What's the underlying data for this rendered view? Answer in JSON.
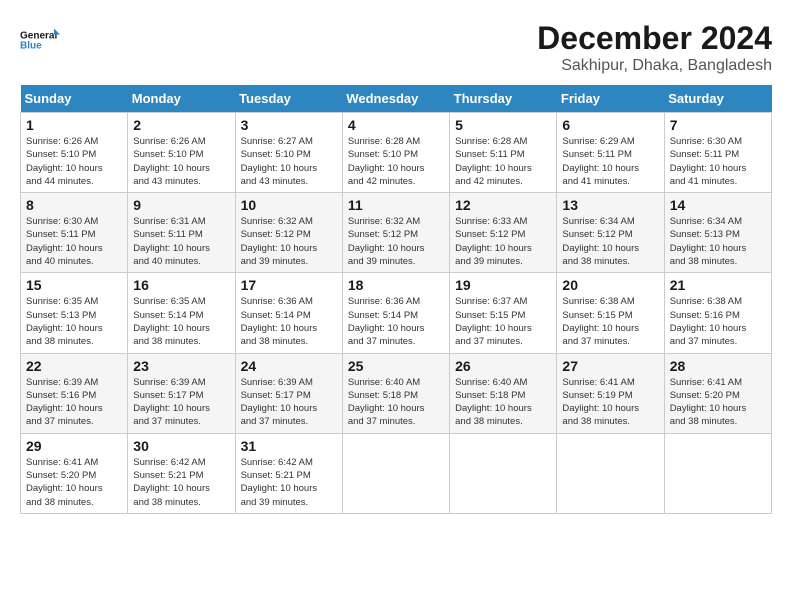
{
  "logo": {
    "text_general": "General",
    "text_blue": "Blue"
  },
  "title": "December 2024",
  "location": "Sakhipur, Dhaka, Bangladesh",
  "days_of_week": [
    "Sunday",
    "Monday",
    "Tuesday",
    "Wednesday",
    "Thursday",
    "Friday",
    "Saturday"
  ],
  "weeks": [
    [
      {
        "day": 1,
        "info": "Sunrise: 6:26 AM\nSunset: 5:10 PM\nDaylight: 10 hours\nand 44 minutes."
      },
      {
        "day": 2,
        "info": "Sunrise: 6:26 AM\nSunset: 5:10 PM\nDaylight: 10 hours\nand 43 minutes."
      },
      {
        "day": 3,
        "info": "Sunrise: 6:27 AM\nSunset: 5:10 PM\nDaylight: 10 hours\nand 43 minutes."
      },
      {
        "day": 4,
        "info": "Sunrise: 6:28 AM\nSunset: 5:10 PM\nDaylight: 10 hours\nand 42 minutes."
      },
      {
        "day": 5,
        "info": "Sunrise: 6:28 AM\nSunset: 5:11 PM\nDaylight: 10 hours\nand 42 minutes."
      },
      {
        "day": 6,
        "info": "Sunrise: 6:29 AM\nSunset: 5:11 PM\nDaylight: 10 hours\nand 41 minutes."
      },
      {
        "day": 7,
        "info": "Sunrise: 6:30 AM\nSunset: 5:11 PM\nDaylight: 10 hours\nand 41 minutes."
      }
    ],
    [
      {
        "day": 8,
        "info": "Sunrise: 6:30 AM\nSunset: 5:11 PM\nDaylight: 10 hours\nand 40 minutes."
      },
      {
        "day": 9,
        "info": "Sunrise: 6:31 AM\nSunset: 5:11 PM\nDaylight: 10 hours\nand 40 minutes."
      },
      {
        "day": 10,
        "info": "Sunrise: 6:32 AM\nSunset: 5:12 PM\nDaylight: 10 hours\nand 39 minutes."
      },
      {
        "day": 11,
        "info": "Sunrise: 6:32 AM\nSunset: 5:12 PM\nDaylight: 10 hours\nand 39 minutes."
      },
      {
        "day": 12,
        "info": "Sunrise: 6:33 AM\nSunset: 5:12 PM\nDaylight: 10 hours\nand 39 minutes."
      },
      {
        "day": 13,
        "info": "Sunrise: 6:34 AM\nSunset: 5:12 PM\nDaylight: 10 hours\nand 38 minutes."
      },
      {
        "day": 14,
        "info": "Sunrise: 6:34 AM\nSunset: 5:13 PM\nDaylight: 10 hours\nand 38 minutes."
      }
    ],
    [
      {
        "day": 15,
        "info": "Sunrise: 6:35 AM\nSunset: 5:13 PM\nDaylight: 10 hours\nand 38 minutes."
      },
      {
        "day": 16,
        "info": "Sunrise: 6:35 AM\nSunset: 5:14 PM\nDaylight: 10 hours\nand 38 minutes."
      },
      {
        "day": 17,
        "info": "Sunrise: 6:36 AM\nSunset: 5:14 PM\nDaylight: 10 hours\nand 38 minutes."
      },
      {
        "day": 18,
        "info": "Sunrise: 6:36 AM\nSunset: 5:14 PM\nDaylight: 10 hours\nand 37 minutes."
      },
      {
        "day": 19,
        "info": "Sunrise: 6:37 AM\nSunset: 5:15 PM\nDaylight: 10 hours\nand 37 minutes."
      },
      {
        "day": 20,
        "info": "Sunrise: 6:38 AM\nSunset: 5:15 PM\nDaylight: 10 hours\nand 37 minutes."
      },
      {
        "day": 21,
        "info": "Sunrise: 6:38 AM\nSunset: 5:16 PM\nDaylight: 10 hours\nand 37 minutes."
      }
    ],
    [
      {
        "day": 22,
        "info": "Sunrise: 6:39 AM\nSunset: 5:16 PM\nDaylight: 10 hours\nand 37 minutes."
      },
      {
        "day": 23,
        "info": "Sunrise: 6:39 AM\nSunset: 5:17 PM\nDaylight: 10 hours\nand 37 minutes."
      },
      {
        "day": 24,
        "info": "Sunrise: 6:39 AM\nSunset: 5:17 PM\nDaylight: 10 hours\nand 37 minutes."
      },
      {
        "day": 25,
        "info": "Sunrise: 6:40 AM\nSunset: 5:18 PM\nDaylight: 10 hours\nand 37 minutes."
      },
      {
        "day": 26,
        "info": "Sunrise: 6:40 AM\nSunset: 5:18 PM\nDaylight: 10 hours\nand 38 minutes."
      },
      {
        "day": 27,
        "info": "Sunrise: 6:41 AM\nSunset: 5:19 PM\nDaylight: 10 hours\nand 38 minutes."
      },
      {
        "day": 28,
        "info": "Sunrise: 6:41 AM\nSunset: 5:20 PM\nDaylight: 10 hours\nand 38 minutes."
      }
    ],
    [
      {
        "day": 29,
        "info": "Sunrise: 6:41 AM\nSunset: 5:20 PM\nDaylight: 10 hours\nand 38 minutes."
      },
      {
        "day": 30,
        "info": "Sunrise: 6:42 AM\nSunset: 5:21 PM\nDaylight: 10 hours\nand 38 minutes."
      },
      {
        "day": 31,
        "info": "Sunrise: 6:42 AM\nSunset: 5:21 PM\nDaylight: 10 hours\nand 39 minutes."
      },
      {
        "day": null,
        "info": ""
      },
      {
        "day": null,
        "info": ""
      },
      {
        "day": null,
        "info": ""
      },
      {
        "day": null,
        "info": ""
      }
    ]
  ]
}
